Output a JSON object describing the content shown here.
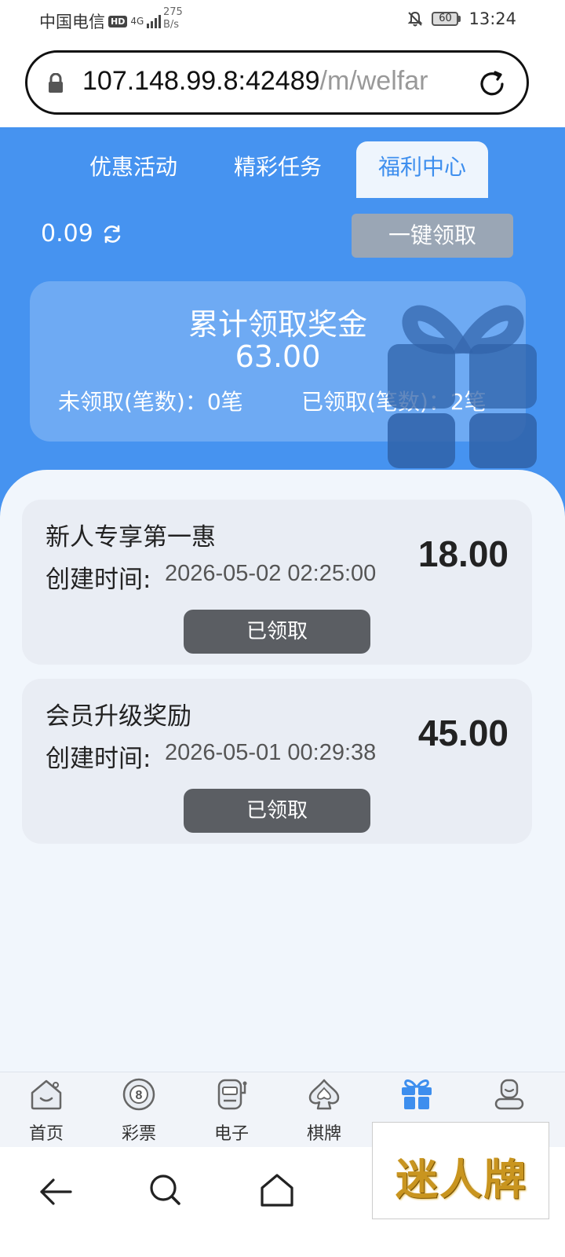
{
  "status_bar": {
    "carrier": "中国电信",
    "hd": "HD",
    "network": "4G",
    "speed_value": "275",
    "speed_unit": "B/s",
    "battery": "60",
    "time": "13:24"
  },
  "url_bar": {
    "host": "107.148.99.8:42489",
    "path": "/m/welfar"
  },
  "tabs": [
    {
      "label": "优惠活动",
      "active": false
    },
    {
      "label": "精彩任务",
      "active": false
    },
    {
      "label": "福利中心",
      "active": true
    }
  ],
  "balance": "0.09",
  "claim_all_label": "一键领取",
  "summary": {
    "title": "累计领取奖金",
    "amount": "63.00",
    "unclaimed": "未领取(笔数)：0笔",
    "claimed": "已领取(笔数)：2笔"
  },
  "rewards": [
    {
      "title": "新人专享第一惠",
      "time_label": "创建时间:",
      "time": "2026-05-02 02:25:00",
      "amount": "18.00",
      "button": "已领取"
    },
    {
      "title": "会员升级奖励",
      "time_label": "创建时间:",
      "time": "2026-05-01 00:29:38",
      "amount": "45.00",
      "button": "已领取"
    }
  ],
  "bottom_nav": [
    {
      "label": "首页",
      "icon": "home-icon"
    },
    {
      "label": "彩票",
      "icon": "lottery-ball-icon"
    },
    {
      "label": "电子",
      "icon": "slot-machine-icon"
    },
    {
      "label": "棋牌",
      "icon": "spade-icon"
    },
    {
      "label": "",
      "icon": "gift-icon",
      "active": true
    },
    {
      "label": "",
      "icon": "profile-icon"
    }
  ],
  "brand_text": "迷人牌",
  "colors": {
    "accent": "#4693f0",
    "active_tab_text": "#3d8eee",
    "button_dark": "#5b5e63",
    "claim_all_bg": "#9aa6b5"
  }
}
